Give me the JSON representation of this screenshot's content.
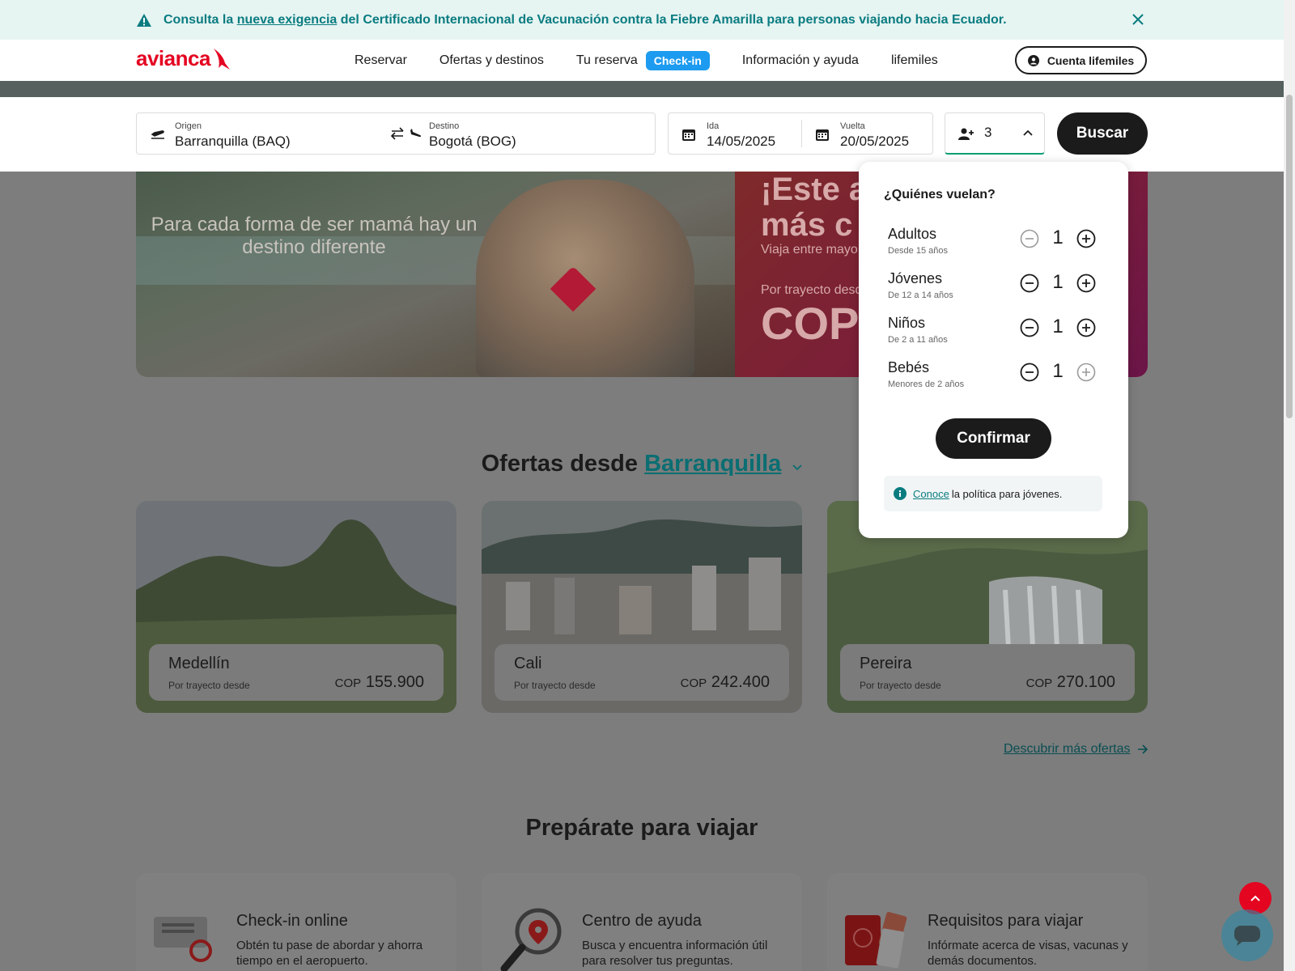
{
  "alert": {
    "prefix": "Consulta la ",
    "link": "nueva exigencia",
    "suffix": " del Certificado Internacional de Vacunación contra la Fiebre Amarilla para personas viajando hacia Ecuador."
  },
  "header": {
    "logo": "avianca",
    "nav": [
      "Reservar",
      "Ofertas y destinos",
      "Tu reserva",
      "Información y ayuda",
      "lifemiles"
    ],
    "checkin_badge": "Check-in",
    "account": "Cuenta lifemiles"
  },
  "search": {
    "origin_label": "Origen",
    "origin_value": "Barranquilla  (BAQ)",
    "destination_label": "Destino",
    "destination_value": "Bogotá  (BOG)",
    "depart_label": "Ida",
    "depart_value": "14/05/2025",
    "return_label": "Vuelta",
    "return_value": "20/05/2025",
    "passengers": "3",
    "search_button": "Buscar"
  },
  "hero": {
    "tagline": "Para cada forma de ser mamá hay un destino diferente",
    "headline1": "¡Este añ",
    "headline2": "más c",
    "sub1": "Viaja entre mayo y",
    "sub2": "Por trayecto desd",
    "price": "COP"
  },
  "offers": {
    "title_prefix": "Ofertas desde ",
    "city": "Barranquilla",
    "cards": [
      {
        "name": "Medellín",
        "from": "Por trayecto desde",
        "currency": "COP",
        "price": "155.900"
      },
      {
        "name": "Cali",
        "from": "Por trayecto desde",
        "currency": "COP",
        "price": "242.400"
      },
      {
        "name": "Pereira",
        "from": "Por trayecto desde",
        "currency": "COP",
        "price": "270.100"
      }
    ],
    "more": "Descubrir más ofertas"
  },
  "prepare": {
    "title": "Prepárate para viajar",
    "cards": [
      {
        "title": "Check-in online",
        "desc": "Obtén tu pase de abordar y ahorra tiempo en el aeropuerto."
      },
      {
        "title": "Centro de ayuda",
        "desc": "Busca y encuentra información útil para resolver tus preguntas."
      },
      {
        "title": "Requisitos para viajar",
        "desc": "Infórmate acerca de visas, vacunas y demás documentos."
      }
    ]
  },
  "popup": {
    "title": "¿Quiénes vuelan?",
    "rows": [
      {
        "name": "Adultos",
        "hint": "Desde 15 años",
        "count": "1"
      },
      {
        "name": "Jóvenes",
        "hint": "De 12 a 14 años",
        "count": "1"
      },
      {
        "name": "Niños",
        "hint": "De 2 a 11 años",
        "count": "1"
      },
      {
        "name": "Bebés",
        "hint": "Menores de 2 años",
        "count": "1"
      }
    ],
    "confirm": "Confirmar",
    "info_link": "Conoce",
    "info_text": "la política para jóvenes."
  },
  "colors": {
    "brand": "#e40521",
    "teal": "#0a7c80",
    "badge": "#1d9bf0"
  }
}
